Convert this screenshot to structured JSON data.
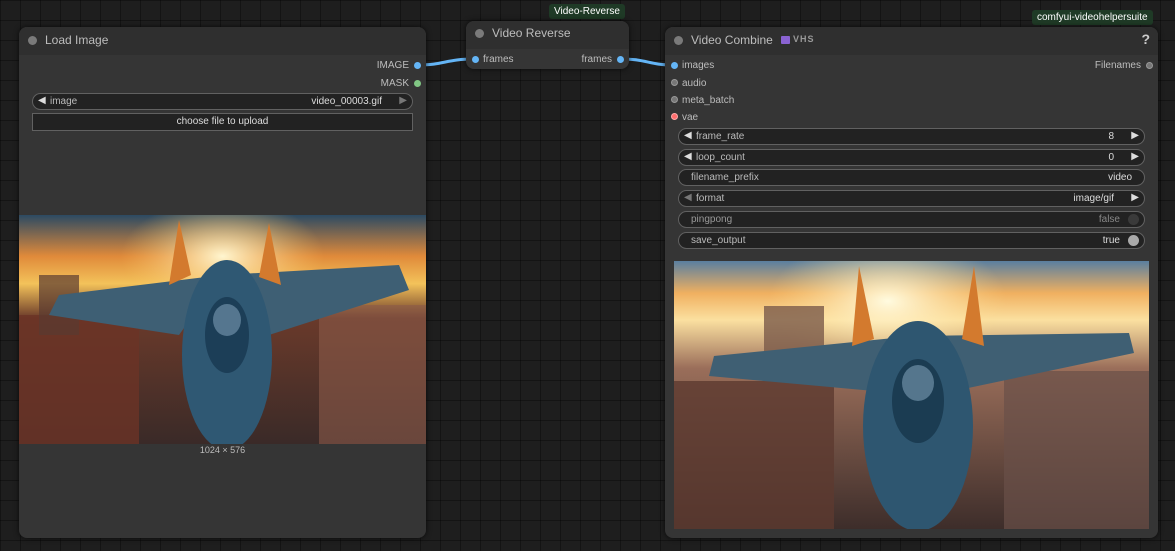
{
  "colors": {
    "canvas_bg": "#1e1e1e",
    "node_bg": "#353535",
    "image_link": "#64b5f6",
    "mask_link": "#81c784",
    "vae_link": "#ff6e6e",
    "tag_bg": "#1f3a26"
  },
  "tags": {
    "reverse": "Video-Reverse",
    "vhs_suite": "comfyui-videohelpersuite"
  },
  "load_image": {
    "title": "Load Image",
    "outputs": [
      "IMAGE",
      "MASK"
    ],
    "image_widget": {
      "name": "image",
      "value": "video_00003.gif"
    },
    "upload_button": "choose file to upload",
    "preview_caption": "1024 × 576"
  },
  "video_reverse": {
    "title": "Video Reverse",
    "input": "frames",
    "output": "frames"
  },
  "video_combine": {
    "title": "Video Combine",
    "badge_icon": "film-icon",
    "badge_text": "VHS",
    "help": "?",
    "inputs": [
      "images",
      "audio",
      "meta_batch",
      "vae"
    ],
    "output": "Filenames",
    "widgets": {
      "frame_rate": {
        "name": "frame_rate",
        "value": "8"
      },
      "loop_count": {
        "name": "loop_count",
        "value": "0"
      },
      "filename_prefix": {
        "name": "filename_prefix",
        "value": "video"
      },
      "format": {
        "name": "format",
        "value": "image/gif"
      },
      "pingpong": {
        "name": "pingpong",
        "value": "false"
      },
      "save_output": {
        "name": "save_output",
        "value": "true"
      }
    }
  }
}
